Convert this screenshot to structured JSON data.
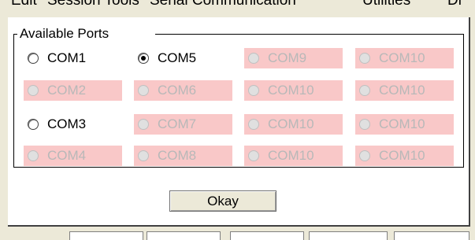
{
  "background_app": {
    "menu_items": [
      "Edit",
      "Session Tools",
      "Serial Communication",
      "Utilities",
      "Di"
    ]
  },
  "dialog": {
    "group_title": "Available Ports",
    "ports": [
      {
        "label": "COM1",
        "enabled": true,
        "selected": false
      },
      {
        "label": "COM5",
        "enabled": true,
        "selected": true
      },
      {
        "label": "COM9",
        "enabled": false,
        "selected": false
      },
      {
        "label": "COM10",
        "enabled": false,
        "selected": false
      },
      {
        "label": "COM2",
        "enabled": false,
        "selected": false
      },
      {
        "label": "COM6",
        "enabled": false,
        "selected": false
      },
      {
        "label": "COM10",
        "enabled": false,
        "selected": false
      },
      {
        "label": "COM10",
        "enabled": false,
        "selected": false
      },
      {
        "label": "COM3",
        "enabled": true,
        "selected": false
      },
      {
        "label": "COM7",
        "enabled": false,
        "selected": false
      },
      {
        "label": "COM10",
        "enabled": false,
        "selected": false
      },
      {
        "label": "COM10",
        "enabled": false,
        "selected": false
      },
      {
        "label": "COM4",
        "enabled": false,
        "selected": false
      },
      {
        "label": "COM8",
        "enabled": false,
        "selected": false
      },
      {
        "label": "COM10",
        "enabled": false,
        "selected": false
      },
      {
        "label": "COM10",
        "enabled": false,
        "selected": false
      }
    ],
    "okay_label": "Okay"
  },
  "colors": {
    "disabled_bg": "#f9c8c8",
    "disabled_text": "#b8b8b8",
    "dialog_bg": "#ffffff"
  }
}
